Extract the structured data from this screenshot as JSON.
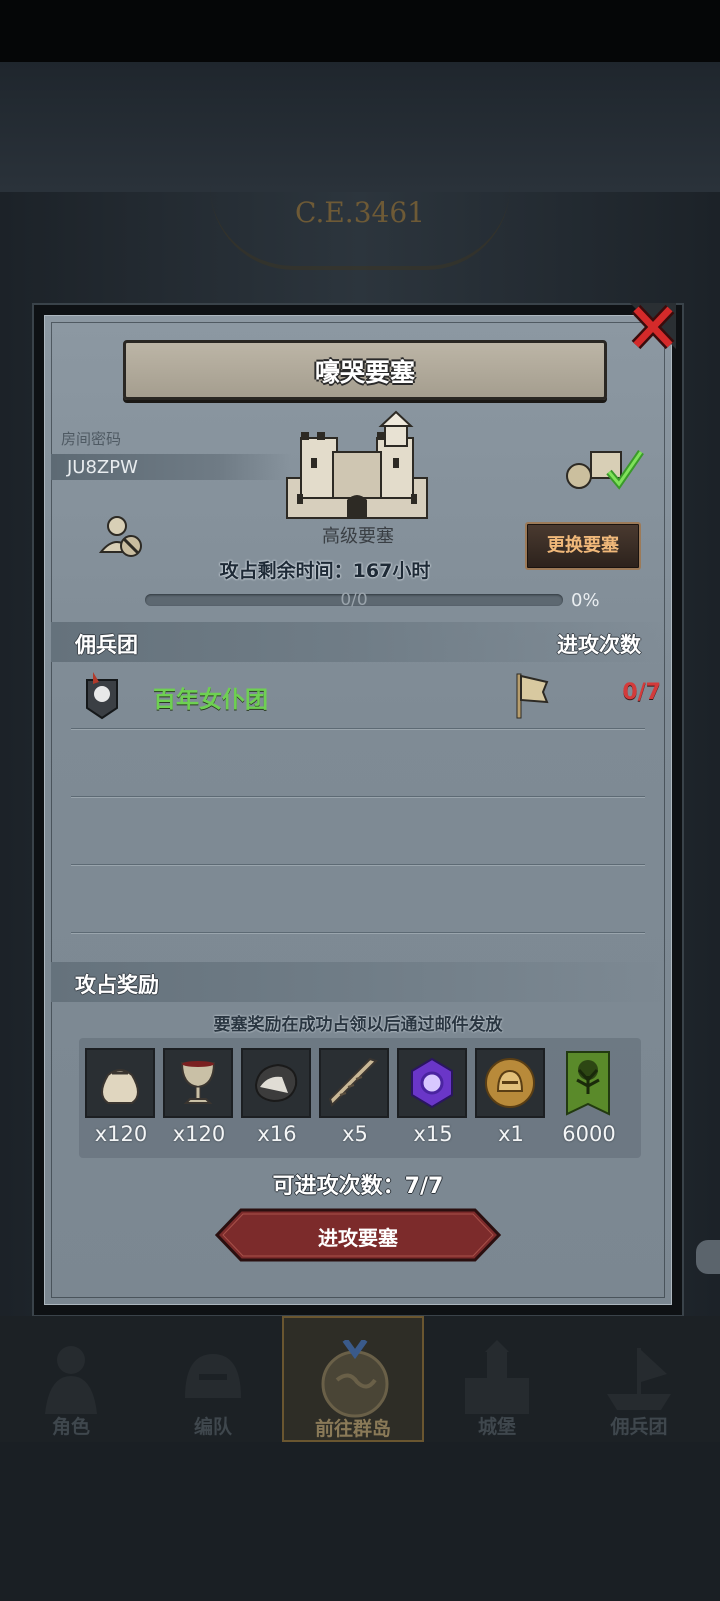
{
  "background": {
    "era_text": "C.E.3461"
  },
  "dialog": {
    "title": "嚎哭要塞",
    "room_label": "房间密码",
    "room_code": "JU8ZPW",
    "fort_type": "高级要塞",
    "time_left": "攻占剩余时间：167小时",
    "change_button": "更换要塞",
    "progress": {
      "text": "0/0",
      "percent_text": "0%",
      "fraction": 0
    },
    "mercenary_header": "佣兵团",
    "attack_count_header": "进攻次数",
    "mercenary_rows": [
      {
        "name": "百年女仆团",
        "attack_count": "0/7"
      }
    ],
    "rewards_header": "攻占奖励",
    "rewards_note": "要塞奖励在成功占领以后通过邮件发放",
    "rewards": [
      {
        "icon": "sack-icon",
        "count": "x120"
      },
      {
        "icon": "goblet-icon",
        "count": "x120"
      },
      {
        "icon": "ore-rock-icon",
        "count": "x16"
      },
      {
        "icon": "horn-icon",
        "count": "x5"
      },
      {
        "icon": "purple-crystal-icon",
        "count": "x15"
      },
      {
        "icon": "gold-helmet-coin-icon",
        "count": "x1"
      },
      {
        "icon": "tree-banner-icon",
        "count": "6000"
      }
    ],
    "remaining_attacks": "可进攻次数：7/7",
    "attack_button": "进攻要塞"
  },
  "bottom_nav": [
    {
      "label": "角色",
      "icon": "knight-icon",
      "active": false
    },
    {
      "label": "编队",
      "icon": "helmet-formation-icon",
      "active": false
    },
    {
      "label": "前往群岛",
      "icon": "globe-icon",
      "active": true
    },
    {
      "label": "城堡",
      "icon": "castle-icon",
      "active": false
    },
    {
      "label": "佣兵团",
      "icon": "ship-icon",
      "active": false
    }
  ],
  "colors": {
    "accent_gold": "#f0b87a",
    "merc_name_green": "#6ed052",
    "attack_count_red": "#d33b3b",
    "attack_button_red": "#7c2b2b"
  }
}
